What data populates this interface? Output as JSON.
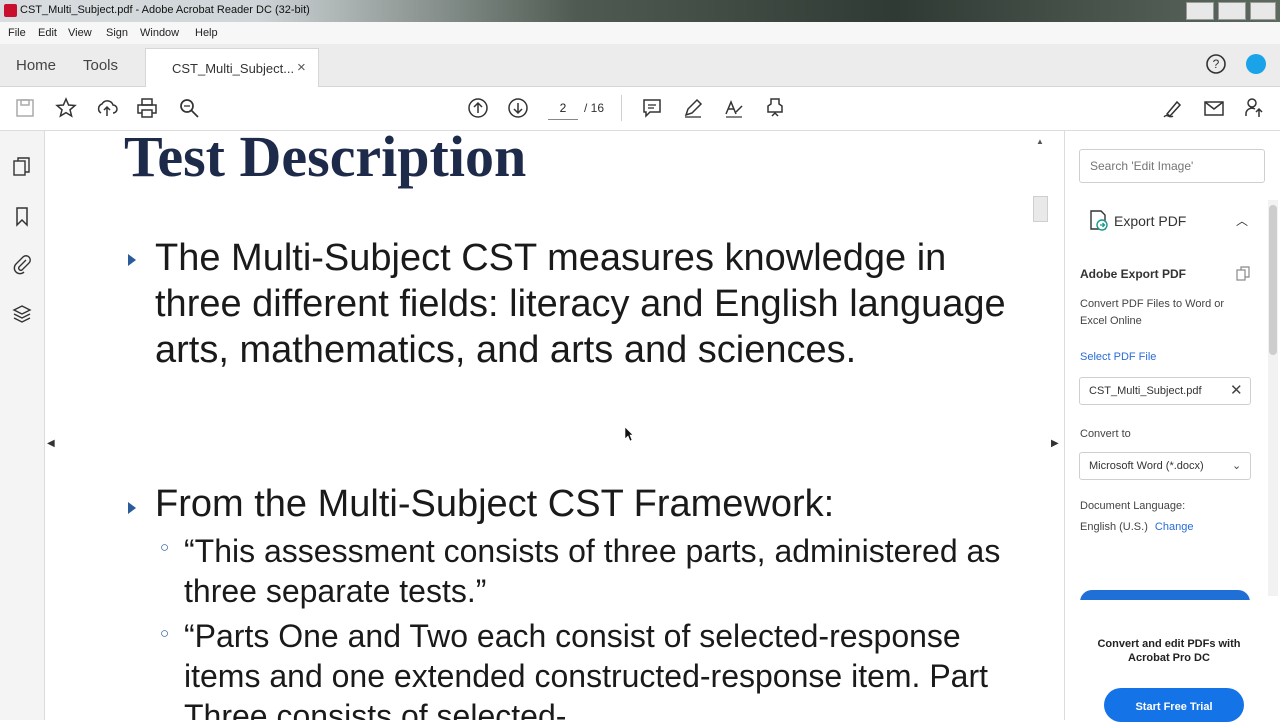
{
  "window": {
    "title": "CST_Multi_Subject.pdf - Adobe Acrobat Reader DC (32-bit)"
  },
  "menu": [
    "File",
    "Edit",
    "View",
    "Sign",
    "Window",
    "Help"
  ],
  "tabs": {
    "home": "Home",
    "tools": "Tools",
    "document": "CST_Multi_Subject...",
    "close": "×"
  },
  "toolbar": {
    "page_current": "2",
    "page_total": "/ 16"
  },
  "document": {
    "heading": "Test Description",
    "bullets": [
      "The Multi-Subject CST measures knowledge in three different fields: literacy and English language arts, mathematics, and arts and sciences.",
      "From the Multi-Subject CST Framework:"
    ],
    "sub_bullets": [
      "“This assessment consists of three parts, administered as three separate tests.”",
      "“Parts One and Two each consist of selected-response items and one extended constructed-response item. Part Three consists of selected-"
    ]
  },
  "right_panel": {
    "search_placeholder": "Search 'Edit Image'",
    "export_title": "Export PDF",
    "section_title": "Adobe Export PDF",
    "description": "Convert PDF Files to Word or Excel Online",
    "select_file_label": "Select PDF File",
    "selected_file": "CST_Multi_Subject.pdf",
    "convert_to_label": "Convert to",
    "convert_to_value": "Microsoft Word (*.docx)",
    "doc_language_label": "Document Language:",
    "doc_language_value": "English (U.S.)",
    "change_link": "Change",
    "promo_text": "Convert and edit PDFs with Acrobat Pro DC",
    "trial_button": "Start Free Trial"
  },
  "colors": {
    "heading": "#1d2a4a",
    "bullet_marker": "#2a5b9a",
    "link": "#2a6bd8",
    "primary_button": "#1473e6"
  }
}
